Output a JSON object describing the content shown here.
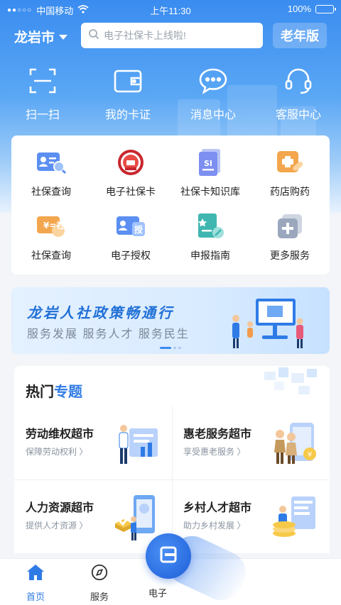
{
  "status_bar": {
    "carrier": "中国移动",
    "time": "上午11:30",
    "battery": "100%",
    "signal_dots": "●●○○○"
  },
  "header": {
    "city": "龙岩市",
    "search_placeholder": "电子社保卡上线啦!",
    "elder_mode": "老年版"
  },
  "quick_actions": [
    {
      "label": "扫一扫",
      "icon": "scan-icon"
    },
    {
      "label": "我的卡证",
      "icon": "wallet-icon"
    },
    {
      "label": "消息中心",
      "icon": "message-icon"
    },
    {
      "label": "客服中心",
      "icon": "headset-icon"
    }
  ],
  "services": [
    {
      "label": "社保查询",
      "icon": "id-search-icon"
    },
    {
      "label": "电子社保卡",
      "icon": "social-card-seal-icon"
    },
    {
      "label": "社保卡知识库",
      "icon": "knowledge-base-icon"
    },
    {
      "label": "药店购药",
      "icon": "pharmacy-icon"
    },
    {
      "label": "社保查询",
      "icon": "social-payment-icon",
      "icon_text": "¥=社"
    },
    {
      "label": "电子授权",
      "icon": "authorize-icon",
      "icon_text": "授"
    },
    {
      "label": "申报指南",
      "icon": "guide-icon"
    },
    {
      "label": "更多服务",
      "icon": "more-services-icon"
    }
  ],
  "banner": {
    "title": "龙岩人社政策畅通行",
    "subtitle": "服务发展 服务人才 服务民生"
  },
  "hot_topics": {
    "title_prefix": "热门",
    "title_highlight": "专题",
    "items": [
      {
        "name": "劳动维权超市",
        "sub": "保障劳动权利 〉",
        "art": "labor-rights-illustration"
      },
      {
        "name": "惠老服务超市",
        "sub": "享受惠老服务 〉",
        "art": "elderly-service-illustration"
      },
      {
        "name": "人力资源超市",
        "sub": "提供人才资源 〉",
        "art": "hr-resources-illustration"
      },
      {
        "name": "乡村人才超市",
        "sub": "助力乡村发展 〉",
        "art": "rural-talent-illustration"
      }
    ]
  },
  "tabs": [
    {
      "label": "首页",
      "icon": "home-icon",
      "active": true
    },
    {
      "label": "服务",
      "icon": "compass-icon",
      "active": false
    },
    {
      "label": "电子",
      "icon": "card-icon",
      "active": false
    }
  ],
  "colors": {
    "primary": "#3a8cf0",
    "accent": "#2f7be6",
    "tab_active": "#2f7be6",
    "tab_inactive": "#333333"
  },
  "chart_data": null
}
